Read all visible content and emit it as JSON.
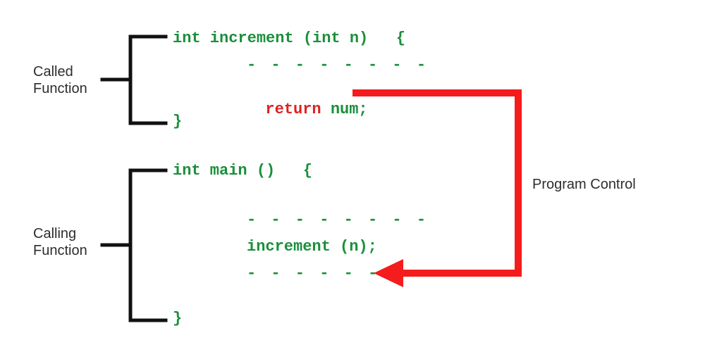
{
  "labels": {
    "called": "Called\nFunction",
    "calling": "Calling\nFunction",
    "program_control": "Program Control"
  },
  "code": {
    "called_sig": "int increment (int n)   {",
    "dashes": "- - - - - - - -",
    "return_kw": "return",
    "return_rest": " num;",
    "close_brace": "}",
    "main_sig": "int main ()   {",
    "call_line": "increment (n);"
  },
  "colors": {
    "code_green": "#1a8f3a",
    "kw_red": "#e02020",
    "arrow_red": "#f41c1c",
    "bracket": "#111111",
    "text": "#2d2d2d"
  }
}
